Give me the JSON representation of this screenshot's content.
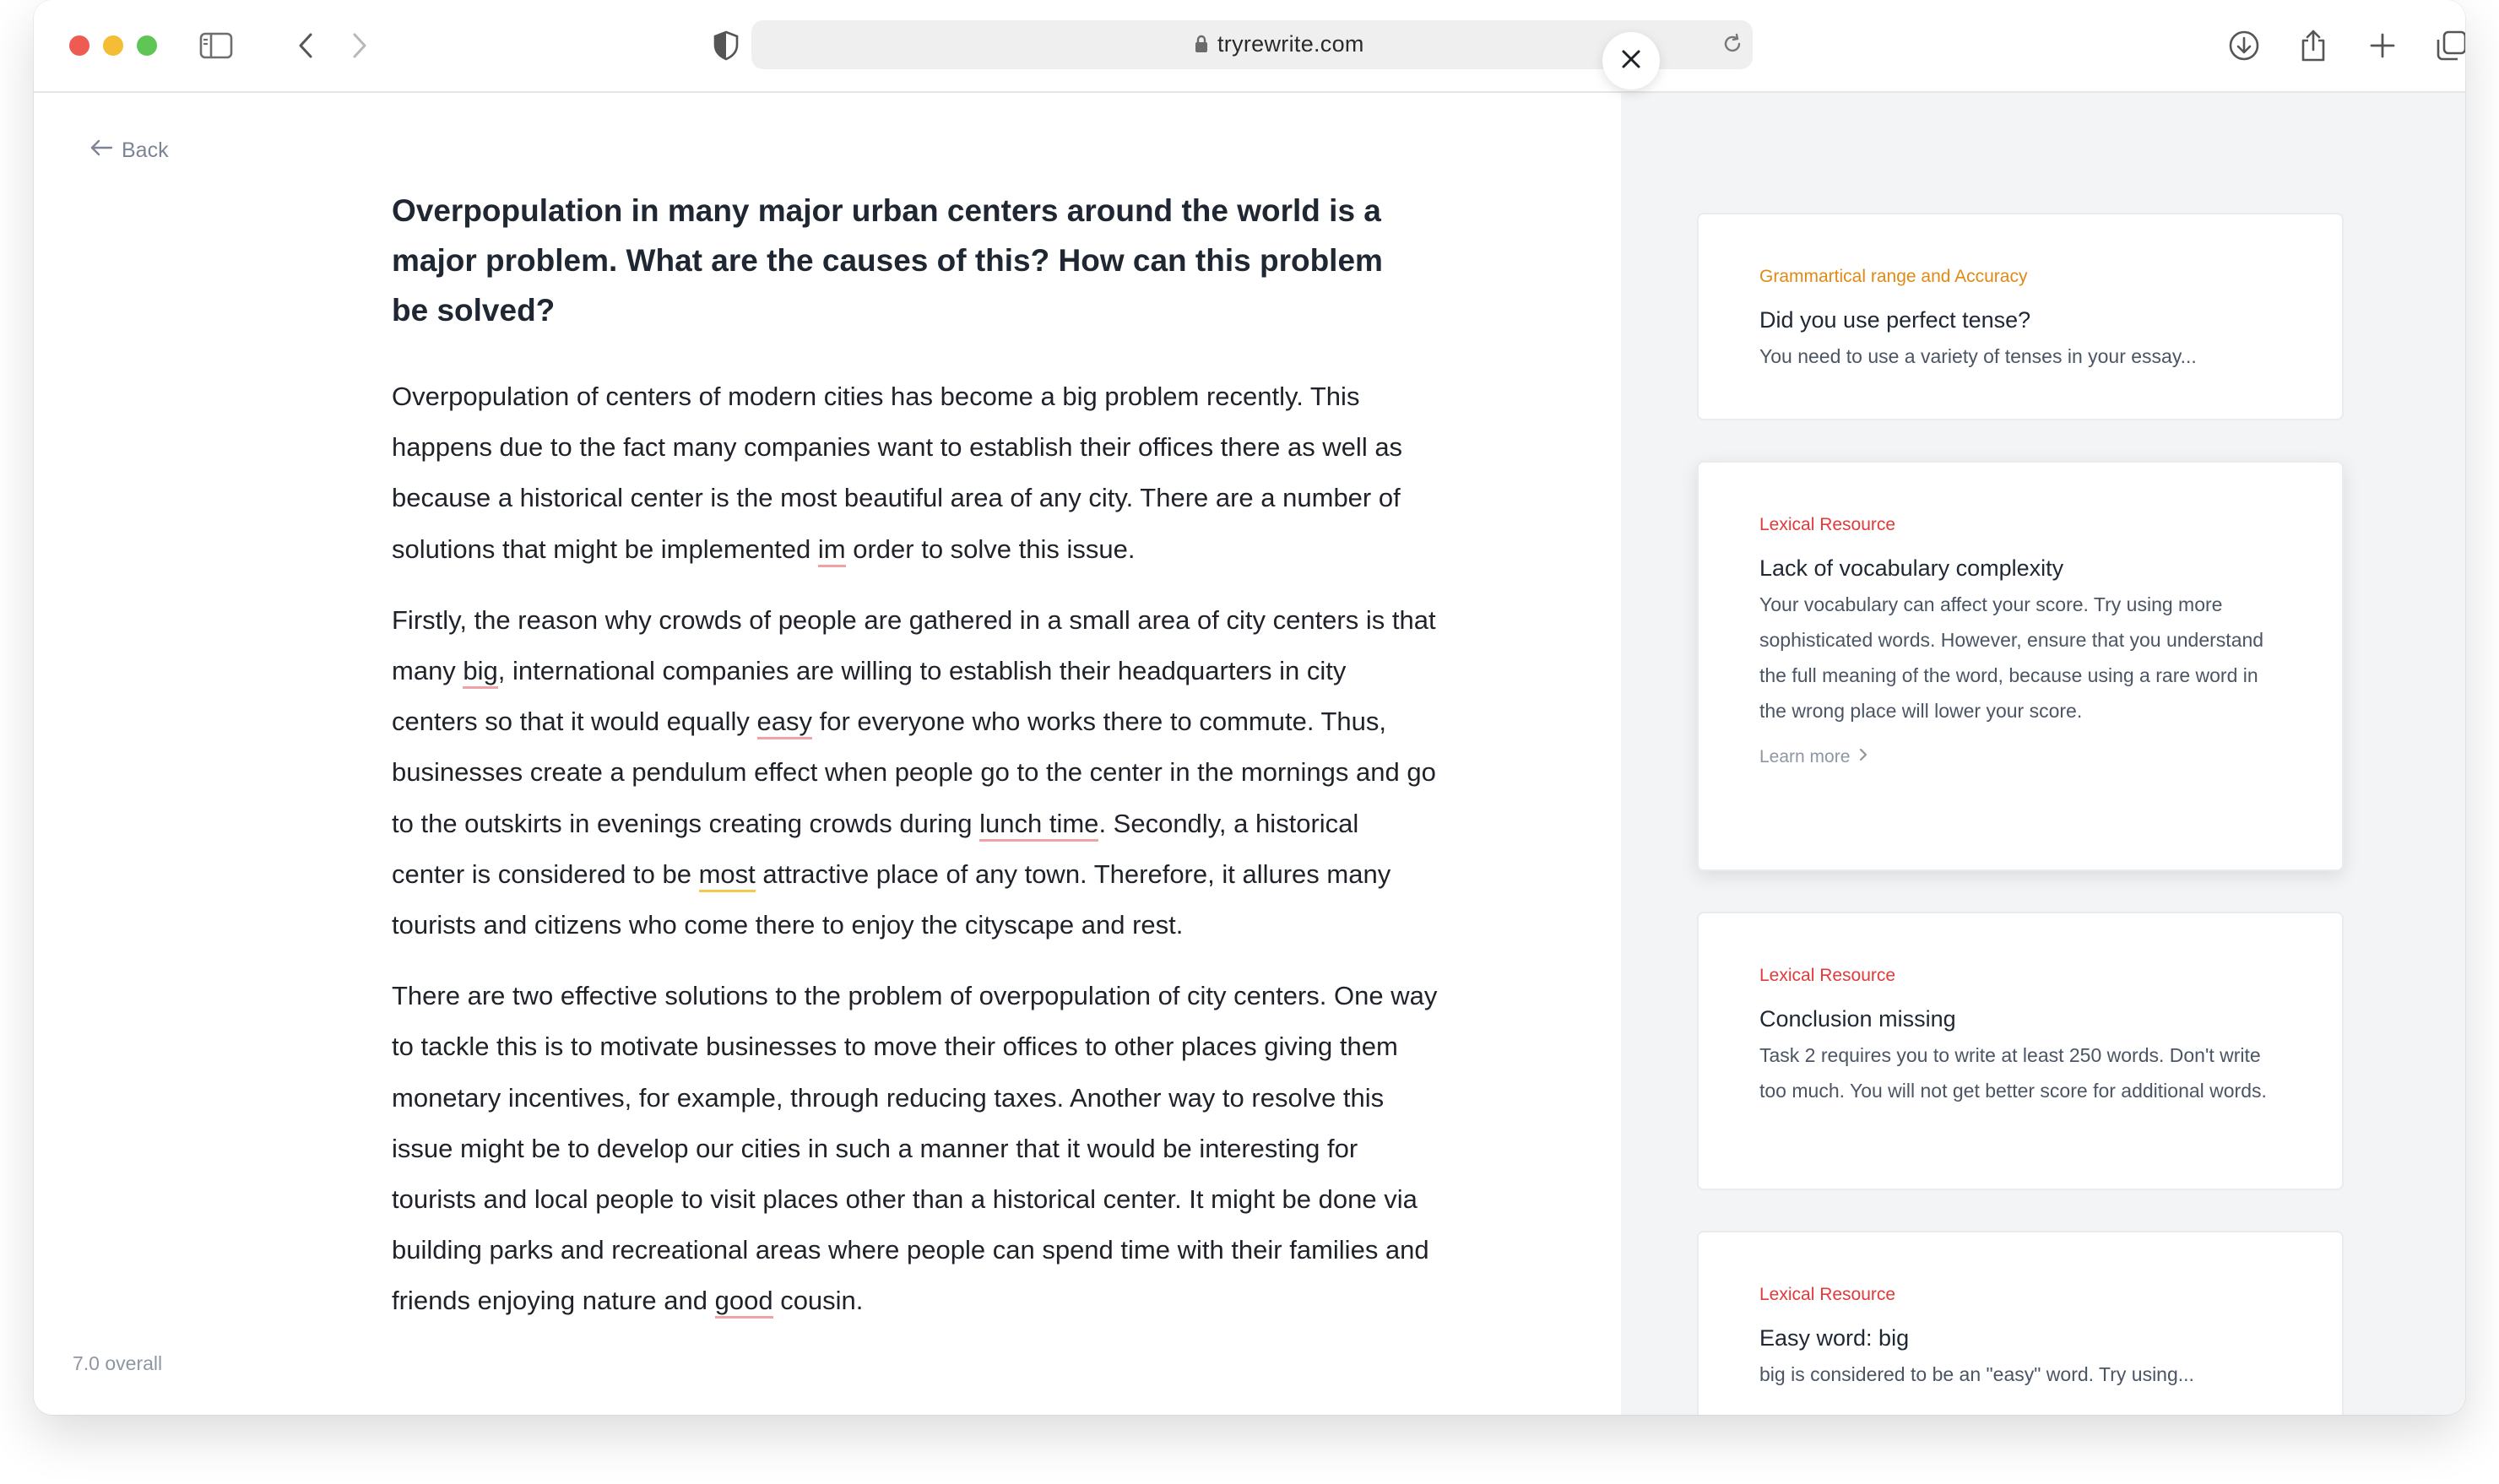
{
  "browser": {
    "url": "tryrewrite.com"
  },
  "nav": {
    "back_label": "Back",
    "overall_score": "7.0 overall"
  },
  "question": "Overpopulation in many major urban centers around the world is a major problem. What are the causes of this? How can this problem be solved?",
  "essay": {
    "p1": {
      "a": "Overpopulation of centers of modern cities has become a big problem recently. This happens due to the fact many companies want to establish their offices there as well as because a historical center is the most beautiful area of any city. There are a number of solutions that might be implemented ",
      "w1": "im",
      "b": " order to solve this issue."
    },
    "p2": {
      "a": "Firstly, the reason why crowds of people are gathered in a small area of city centers is that many ",
      "w1": "big",
      "b": ", international companies are willing to establish their headquarters in city centers so that it would equally ",
      "w2": "easy",
      "c": " for everyone who works there to commute. Thus, businesses create a pendulum effect when people go to the center in the mornings and go to the outskirts in evenings creating crowds during ",
      "w3": "lunch time",
      "d": ". Secondly, a historical center is considered to be ",
      "w4": "most",
      "e": " attractive place of any town. Therefore, it allures many tourists and citizens who come there to enjoy the cityscape and rest."
    },
    "p3": {
      "a": "There are two effective solutions to the problem of overpopulation of city centers. One way to tackle this is to motivate businesses to move their offices to other places giving them monetary incentives, for example, through reducing taxes. Another way to resolve this issue might be to develop our cities in such a manner that it would be interesting for tourists and local people to visit places other than a historical center. It might be done via building parks and recreational areas where people can spend time with their families and friends enjoying nature and ",
      "w1": "good",
      "b": " cousin."
    }
  },
  "feedback": [
    {
      "category": "Grammartical range and Accuracy",
      "title": "Did you use perfect tense?",
      "body": "You need to use a variety of tenses in your essay..."
    },
    {
      "category": "Lexical Resource",
      "title": "Lack of vocabulary complexity",
      "body": "Your vocabulary can affect your score. Try using more sophisticated words. However, ensure that you understand the full meaning of the word, because using a rare word in the wrong place will lower your score.",
      "link": "Learn more"
    },
    {
      "category": "Lexical Resource",
      "title": "Conclusion missing",
      "body": "Task 2 requires you to write at least 250 words. Don't write too much. You will not get better score for additional words."
    },
    {
      "category": "Lexical Resource",
      "title": "Easy word: big",
      "body": "big is considered to be an \"easy\" word. Try using..."
    }
  ],
  "colors": {
    "error_underline": "#f0a3a6",
    "warning_underline": "#f4c94b",
    "category_orange": "#e08a14",
    "category_red": "#e23a3a",
    "sidebar_bg": "#f3f4f6"
  }
}
